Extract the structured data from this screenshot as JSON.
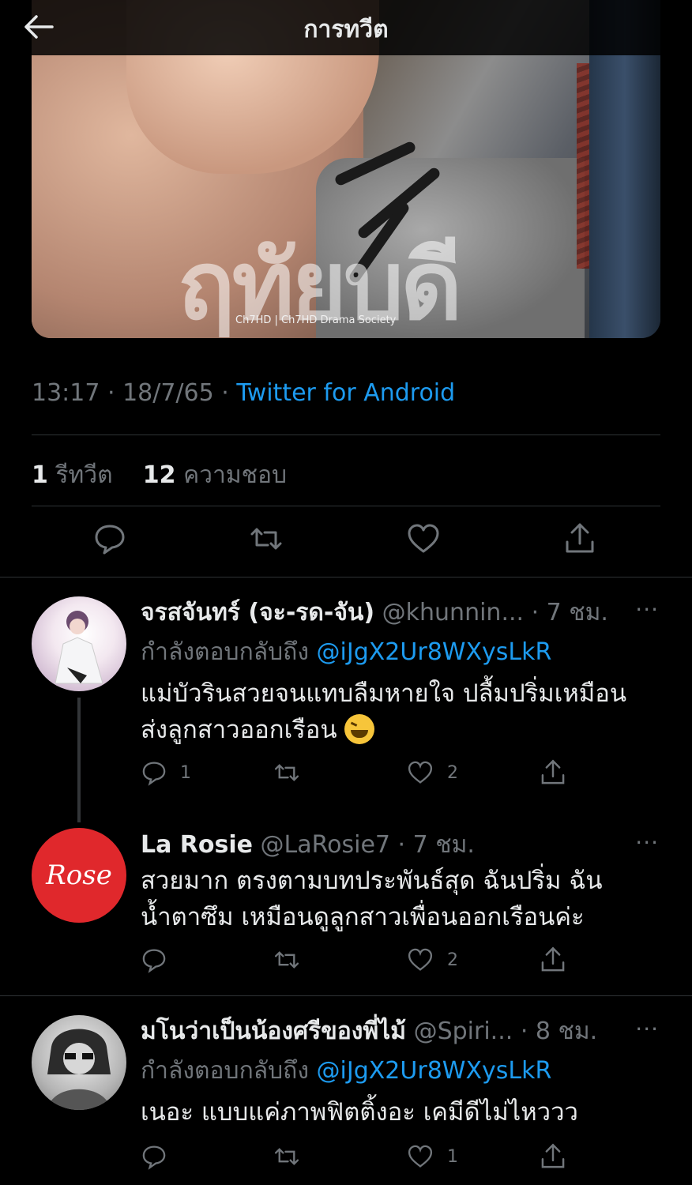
{
  "header": {
    "title": "การทวีต",
    "back_icon": "arrow-left-icon"
  },
  "media": {
    "watermark": "ฤทัยบดี",
    "credit": "Ch7HD | Ch7HD Drama Society"
  },
  "tweet": {
    "time": "13:17 · 18/7/65 · ",
    "source": "Twitter for Android",
    "retweets_count": "1",
    "retweets_label": " รีทวีต",
    "likes_count": "12",
    "likes_label": " ความชอบ"
  },
  "replies": [
    {
      "name": "จรสจันทร์ (จะ-รด-จัน)",
      "handle": " @khunnin... · 7 ชม.",
      "replying_prefix": "กำลังตอบกลับถึง ",
      "replying_to": "@iJgX2Ur8WXysLkR",
      "text_line1": "แม่บัวรินสวยจนแทบลืมหายใจ ปลื้มปริ่มเหมือน",
      "text_line2": "ส่งลูกสาวออกเรือน ",
      "reply_count": "1",
      "like_count": "2"
    },
    {
      "name": "La Rosie",
      "handle": " @LaRosie7 · 7 ชม.",
      "avatar_text": "Rose",
      "text_line1": "สวยมาก ตรงตามบทประพันธ์สุด ฉันปริ่ม ฉัน",
      "text_line2": "น้ำตาซึม เหมือนดูลูกสาวเพื่อนออกเรือนค่ะ",
      "like_count": "2"
    },
    {
      "name": "มโนว่าเป็นน้องศรีของพี่ไม้",
      "handle": " @Spiri... · 8 ชม.",
      "replying_prefix": "กำลังตอบกลับถึง ",
      "replying_to": "@iJgX2Ur8WXysLkR",
      "text_line1": "เนอะ  แบบแค่ภาพฟิตติ้งอะ  เคมีดีไม่ไหววว",
      "like_count": "1"
    }
  ],
  "more_label": "···",
  "colors": {
    "background": "#000000",
    "accent": "#1d9bf0",
    "muted": "#71767b",
    "text": "#e7e9ea",
    "divider": "#2f3336"
  }
}
